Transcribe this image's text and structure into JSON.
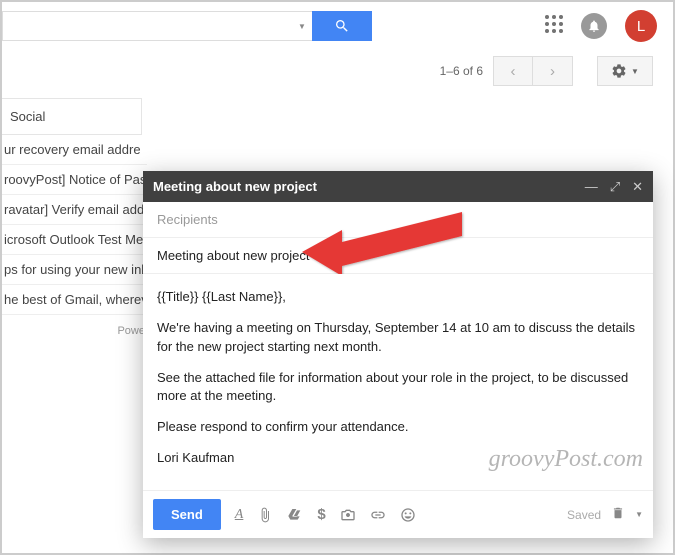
{
  "search": {
    "placeholder": ""
  },
  "avatar": {
    "letter": "L"
  },
  "pager": {
    "text": "1–6 of 6"
  },
  "inbox": {
    "tab": "Social",
    "rows": [
      "ur recovery email addre",
      "roovyPost] Notice of Pas",
      "ravatar] Verify email add",
      "icrosoft Outlook Test Mes",
      "ps for using your new inb",
      "he best of Gmail, wherev"
    ],
    "footer": "Powe"
  },
  "compose": {
    "title": "Meeting about new project",
    "recipients_label": "Recipients",
    "subject": "Meeting about new project",
    "body": {
      "greeting": "{{Title}} {{Last Name}},",
      "p1": "We're having a meeting on Thursday, September 14 at 10 am to discuss the details for the new project starting next month.",
      "p2": "See the attached file for information about your role in the project, to be discussed more at the meeting.",
      "p3": "Please respond to confirm your attendance.",
      "sig": "Lori Kaufman"
    },
    "send": "Send",
    "saved": "Saved"
  },
  "watermark": "groovyPost.com"
}
